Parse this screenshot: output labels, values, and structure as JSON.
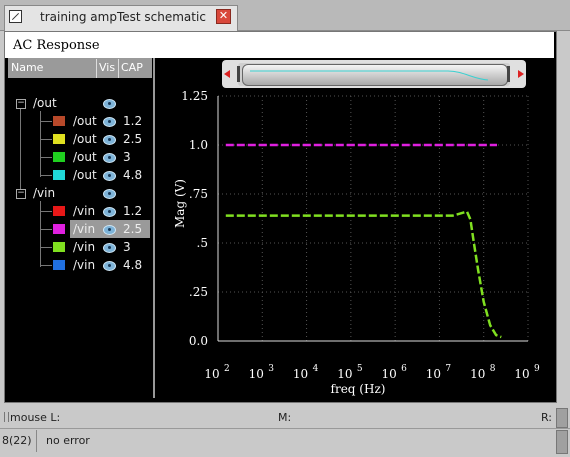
{
  "tab": {
    "title": "training ampTest schematic",
    "close_glyph": "✕"
  },
  "window": {
    "title": "AC Response"
  },
  "columns": {
    "name": "Name",
    "vis": "Vis",
    "cap": "CAP"
  },
  "groups": [
    {
      "label": "/out",
      "expander": "−",
      "items": [
        {
          "label": "/out",
          "cap": "1.2",
          "color": "#b8492a"
        },
        {
          "label": "/out",
          "cap": "2.5",
          "color": "#e0e020"
        },
        {
          "label": "/out",
          "cap": "3",
          "color": "#20d020"
        },
        {
          "label": "/out",
          "cap": "4.8",
          "color": "#20d8d8"
        }
      ]
    },
    {
      "label": "/vin",
      "expander": "−",
      "items": [
        {
          "label": "/vin",
          "cap": "1.2",
          "color": "#e81818"
        },
        {
          "label": "/vin",
          "cap": "2.5",
          "color": "#e020e0",
          "selected": true
        },
        {
          "label": "/vin",
          "cap": "3",
          "color": "#80e020"
        },
        {
          "label": "/vin",
          "cap": "4.8",
          "color": "#2070e0"
        }
      ]
    }
  ],
  "chart_data": {
    "type": "line",
    "xlabel": "freq (Hz)",
    "ylabel": "Mag (V)",
    "x_scale": "log",
    "xlim": [
      100,
      1000000000
    ],
    "ylim": [
      0,
      1.25
    ],
    "grid": true,
    "y_ticks": [
      "0.0",
      ".25",
      ".5",
      ".75",
      "1.0",
      "1.25"
    ],
    "x_ticks": [
      {
        "base": "10",
        "exp": "2"
      },
      {
        "base": "10",
        "exp": "3"
      },
      {
        "base": "10",
        "exp": "4"
      },
      {
        "base": "10",
        "exp": "5"
      },
      {
        "base": "10",
        "exp": "6"
      },
      {
        "base": "10",
        "exp": "7"
      },
      {
        "base": "10",
        "exp": "8"
      },
      {
        "base": "10",
        "exp": "9"
      }
    ],
    "series": [
      {
        "color": "#e020e0",
        "points": [
          [
            150,
            1.0
          ],
          [
            200000000,
            1.0
          ]
        ]
      },
      {
        "color": "#80e020",
        "points": [
          [
            150,
            0.64
          ],
          [
            1000000,
            0.64
          ],
          [
            20000000,
            0.64
          ],
          [
            35000000,
            0.655
          ],
          [
            42000000,
            0.66
          ],
          [
            50000000,
            0.62
          ],
          [
            60000000,
            0.5
          ],
          [
            75000000,
            0.36
          ],
          [
            100000000,
            0.2
          ],
          [
            140000000,
            0.08
          ],
          [
            190000000,
            0.03
          ],
          [
            250000000,
            0.02
          ]
        ]
      }
    ]
  },
  "status": {
    "mouse": "mouse L:",
    "m": "M:",
    "r": "R:",
    "line_no": "8(22)",
    "message": "no error"
  },
  "accent_selected": "#9a9a9a"
}
